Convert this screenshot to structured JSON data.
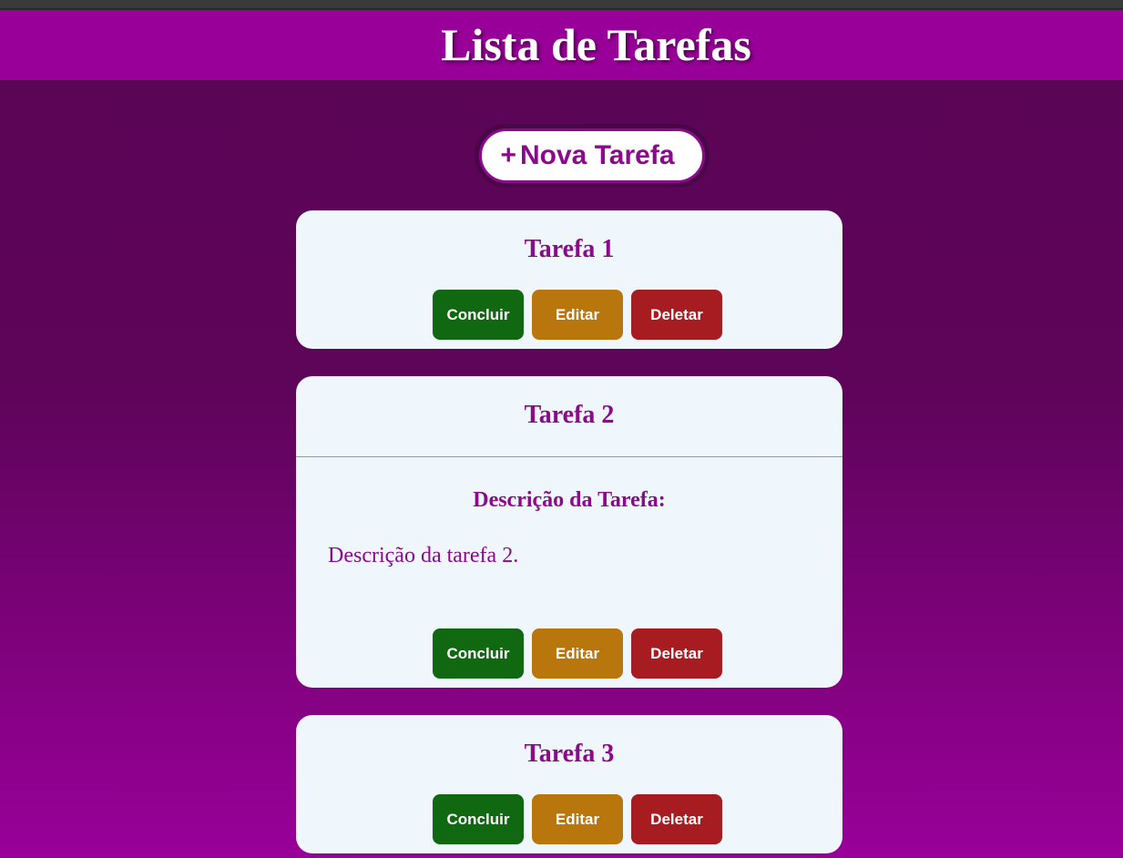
{
  "header": {
    "title": "Lista de Tarefas"
  },
  "new_task_button": {
    "icon": "+",
    "label": "Nova Tarefa"
  },
  "tasks": [
    {
      "title": "Tarefa 1",
      "expanded": false,
      "actions": {
        "complete": "Concluir",
        "edit": "Editar",
        "delete": "Deletar"
      }
    },
    {
      "title": "Tarefa 2",
      "expanded": true,
      "description_heading": "Descrição da Tarefa:",
      "description": "Descrição da tarefa 2.",
      "actions": {
        "complete": "Concluir",
        "edit": "Editar",
        "delete": "Deletar"
      }
    },
    {
      "title": "Tarefa 3",
      "expanded": false,
      "actions": {
        "complete": "Concluir",
        "edit": "Editar",
        "delete": "Deletar"
      }
    }
  ],
  "colors": {
    "header_bg": "#990099",
    "accent": "#8b0a8b",
    "card_bg": "#eff6fc",
    "complete": "#106810",
    "edit": "#b8760c",
    "delete": "#a71c20"
  }
}
